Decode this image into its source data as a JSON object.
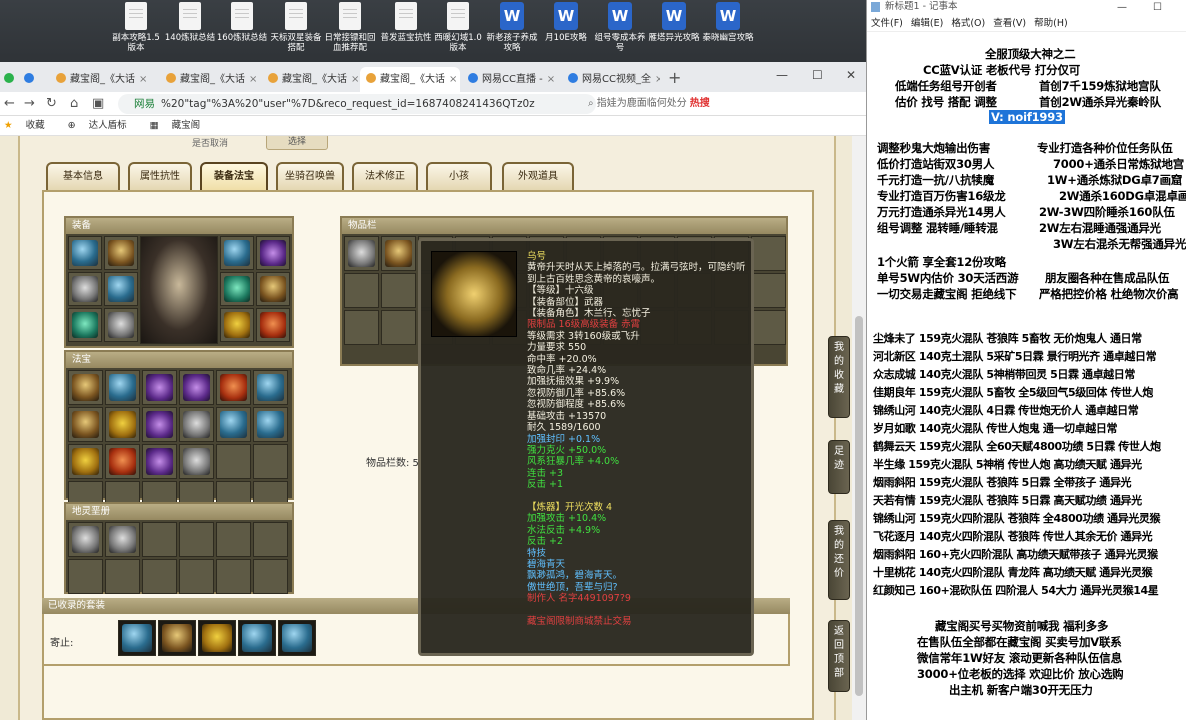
{
  "desktop_icons": [
    {
      "label": "副本攻略1.5版本",
      "type": "doc"
    },
    {
      "label": "140炼狱总结",
      "type": "doc"
    },
    {
      "label": "160炼狱总结",
      "type": "doc"
    },
    {
      "label": "天标双星装备搭配",
      "type": "doc"
    },
    {
      "label": "日常接镖和回血推荐配",
      "type": "doc"
    },
    {
      "label": "普发蓝宝抗性",
      "type": "doc"
    },
    {
      "label": "西暖幻域1.0版本",
      "type": "doc"
    },
    {
      "label": "新老孩子养成攻略",
      "type": "word"
    },
    {
      "label": "月10E攻略",
      "type": "word"
    },
    {
      "label": "组号零成本养号",
      "type": "word"
    },
    {
      "label": "雁塔异光攻略",
      "type": "word"
    },
    {
      "label": "秦晓幽宫攻略",
      "type": "word"
    }
  ],
  "browser": {
    "tabs": [
      {
        "label": "藏宝阁_《大话",
        "active": false
      },
      {
        "label": "藏宝阁_《大话",
        "active": false
      },
      {
        "label": "藏宝阁_《大话",
        "active": false
      },
      {
        "label": "藏宝阁_《大话",
        "active": true
      },
      {
        "label": "网易CC直播 -",
        "active": false
      },
      {
        "label": "网易CC视频_全",
        "active": false
      }
    ],
    "url_site": "网易",
    "url": "%20\"tag\"%3A%20\"user\"%7D&reco_request_id=1687408241436QTz0z",
    "search_placeholder": "指娃为鹿面临何处分",
    "search_hot": "热搜",
    "bookmarks": [
      "收藏",
      "达人盾标",
      "藏宝阁"
    ]
  },
  "game": {
    "top_label": "是否取消",
    "top_button": "选择",
    "tabs": [
      "基本信息",
      "属性抗性",
      "装备法宝",
      "坐骑召唤兽",
      "法术修正",
      "小孩",
      "外观道具"
    ],
    "active_tab": 2,
    "sections": {
      "equip": "装备",
      "fabao": "法宝",
      "dilingjie": "地灵垩册",
      "inventory": "物品栏",
      "suits": "已收录的套装",
      "suit_holder": "寄止:"
    },
    "inventory_count": "物品栏数: 5",
    "tooltip": {
      "lines": [
        {
          "t": "乌号",
          "c": "y"
        },
        {
          "t": "黄帝升天时从天上掉落的弓。拉满弓弦时，可隐约听到上古百姓思念黄帝的哀嚎声。",
          "c": "w"
        },
        {
          "t": "【等级】十六级",
          "c": "w"
        },
        {
          "t": "【装备部位】武器",
          "c": "w"
        },
        {
          "t": "【装备角色】木兰行、忘忧子",
          "c": "w"
        },
        {
          "t": "限制品 16级高级装备 赤霄",
          "c": "r"
        },
        {
          "t": "等级需求 3转160级或飞升",
          "c": "w"
        },
        {
          "t": "力量要求 550",
          "c": "w"
        },
        {
          "t": "命中率 +20.0%",
          "c": "w"
        },
        {
          "t": "致命几率 +24.4%",
          "c": "w"
        },
        {
          "t": "加强抚摇效果 +9.9%",
          "c": "w"
        },
        {
          "t": "忽视防御几率 +85.6%",
          "c": "w"
        },
        {
          "t": "忽视防御程度 +85.6%",
          "c": "w"
        },
        {
          "t": "基础攻击 +13570",
          "c": "w"
        },
        {
          "t": "耐久 1589/1600",
          "c": "w"
        },
        {
          "t": "加强封印 +0.1%",
          "c": "b"
        },
        {
          "t": "强力克火 +50.0%",
          "c": "g"
        },
        {
          "t": "风系狂暴几率 +4.0%",
          "c": "g"
        },
        {
          "t": "连击 +3",
          "c": "g"
        },
        {
          "t": "反击 +1",
          "c": "g"
        },
        {
          "t": "",
          "c": "w"
        },
        {
          "t": "【炼器】开光次数 4",
          "c": "y"
        },
        {
          "t": "加强攻击 +10.4%",
          "c": "g"
        },
        {
          "t": "水法反击 +4.9%",
          "c": "g"
        },
        {
          "t": "反击 +2",
          "c": "g"
        },
        {
          "t": "特技",
          "c": "b"
        },
        {
          "t": "碧海青天",
          "c": "b"
        },
        {
          "t": "飘渺孤鸿，碧海青天。",
          "c": "b"
        },
        {
          "t": "傲世绝顶，吾辈与归?",
          "c": "b"
        },
        {
          "t": "制作人 名字4491097?9",
          "c": "r"
        },
        {
          "t": "",
          "c": "w"
        },
        {
          "t": "藏宝阁限制商城禁止交易",
          "c": "r"
        }
      ]
    },
    "float_buttons": [
      "我的收藏",
      "足迹",
      "我的还价",
      "返回顶部"
    ]
  },
  "notepad": {
    "title": "新标题1 - 记事本",
    "menu": [
      "文件(F)",
      "编辑(E)",
      "格式(O)",
      "查看(V)",
      "帮助(H)"
    ],
    "lines": [
      "全服顶级大神之二",
      "CC蓝V认证 老板代号 打分仅可",
      "低端任务组号开创者",
      "首创7千159炼狱地宫队",
      "估价 找号 搭配 调整",
      "首创2W通杀异光秦岭队",
      "V: noif1993",
      "调整秒鬼大炮输出伤害",
      "专业打造各种价位任务队伍",
      "低价打造站街双30男人",
      "7000+通杀日常炼狱地宫",
      "千元打造一抗/八抗犊魔",
      "1W+通杀炼狱DG卓7画窟",
      "专业打造百万伤害16级龙",
      "2W通杀160DG卓混卓画",
      "万元打造通杀异光14男人",
      "2W-3W四阶睡杀160队伍",
      "组号调整 混转睡/睡转混",
      "2W左右混睡通强通异光",
      "3W左右混杀无帮强通异光",
      "1个火箭 享全套12份攻略",
      "单号5W内估价 30天活西游",
      "朋友圈各种在售成品队伍",
      "一切交易走藏宝阁 拒绝线下",
      "严格把控价格 杜绝物次价高",
      "尘烽未了 159克火混队 苍狼阵 5畜牧 无价炮鬼人 通日常",
      "河北新区 140克土混队 5采矿5日霖 景行明光齐 通卓越日常",
      "众志成城 140克火混队 5神梢带回灵 5日霖 通卓越日常",
      "佳期良年 159克火混队 5畜牧 全5级回气5级回体 传世人炮",
      "锦绣山河 140克火混队 4日霖 传世炮无价人 通卓越日常",
      "岁月如歌 140克火混队 传世人炮鬼 通一切卓越日常",
      "鹤舞云天 159克火混队 全60天赋4800功绩 5日霖 传世人炮",
      "半生缘 159克火混队 5神梢 传世人炮 高功绩天赋 通异光",
      "烟雨斜阳 159克火混队 苍狼阵 5日霖 全带孩子 通异光",
      "天若有情 159克火混队 苍狼阵 5日霖 高天赋功绩 通异光",
      "锦绣山河 159克火四阶混队 苍狼阵 全4800功绩 通异光灵猴",
      "飞花逐月 140克火四阶混队 苍狼阵 传世人其余无价 通异光",
      "烟雨斜阳 160+克火四阶混队 高功绩天赋带孩子 通异光灵猴",
      "十里桃花 140克火四阶混队 青龙阵 高功绩天赋 通异光灵猴",
      "红颜知己 160+混砍队伍 四阶混人 54大力 通异光灵猴14星",
      "藏宝阁买号买物资前喊我 福利多多",
      "在售队伍全部都在藏宝阁 买卖号加V联系",
      "微信常年1W好友 滚动更新各种队伍信息",
      "3000+位老板的选择 欢迎比价 放心选购",
      "出主机 新客户端30开无压力"
    ]
  }
}
